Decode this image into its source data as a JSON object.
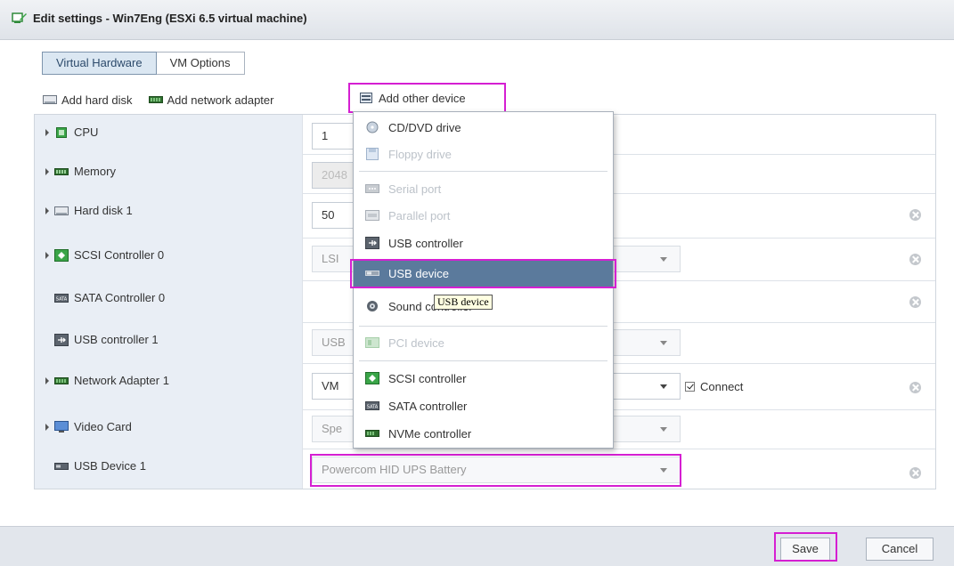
{
  "window": {
    "title": "Edit settings - Win7Eng (ESXi 6.5 virtual machine)"
  },
  "tabs": [
    {
      "label": "Virtual Hardware"
    },
    {
      "label": "VM Options"
    }
  ],
  "toolbar": {
    "add_hard_disk": "Add hard disk",
    "add_network_adapter": "Add network adapter",
    "add_other_device": "Add other device"
  },
  "hardware": [
    {
      "label": "CPU",
      "value": "1",
      "expandable": true
    },
    {
      "label": "Memory",
      "value": "2048",
      "expandable": true
    },
    {
      "label": "Hard disk 1",
      "value": "50",
      "expandable": true
    },
    {
      "label": "SCSI Controller 0",
      "value": "LSI",
      "expandable": true
    },
    {
      "label": "SATA Controller 0",
      "value": "",
      "expandable": false
    },
    {
      "label": "USB controller 1",
      "value": "USB",
      "expandable": false
    },
    {
      "label": "Network Adapter 1",
      "value": "VM",
      "expandable": true,
      "connect": "Connect"
    },
    {
      "label": "Video Card",
      "value": "Spe",
      "expandable": true
    },
    {
      "label": "USB Device 1",
      "value": "Powercom HID UPS Battery",
      "expandable": false
    }
  ],
  "menu": {
    "items": [
      {
        "label": "CD/DVD drive",
        "enabled": true,
        "icon": "disc-icon"
      },
      {
        "label": "Floppy drive",
        "enabled": false,
        "icon": "floppy-icon"
      },
      {
        "label": "Serial port",
        "enabled": false,
        "icon": "serial-port-icon"
      },
      {
        "label": "Parallel port",
        "enabled": false,
        "icon": "parallel-port-icon"
      },
      {
        "label": "USB controller",
        "enabled": true,
        "icon": "usb-controller-icon"
      },
      {
        "label": "USB device",
        "enabled": true,
        "active": true,
        "icon": "usb-device-icon"
      },
      {
        "label": "Sound controller",
        "enabled": true,
        "icon": "sound-icon"
      },
      {
        "label": "PCI device",
        "enabled": false,
        "icon": "pci-icon"
      },
      {
        "label": "SCSI controller",
        "enabled": true,
        "icon": "scsi-icon"
      },
      {
        "label": "SATA controller",
        "enabled": true,
        "icon": "sata-icon"
      },
      {
        "label": "NVMe controller",
        "enabled": true,
        "icon": "nvme-icon"
      }
    ]
  },
  "tooltip": {
    "text": "USB device"
  },
  "footer": {
    "save": "Save",
    "cancel": "Cancel"
  },
  "colors": {
    "highlight": "#d51fd2",
    "menu_active": "#5b7a9c",
    "label_bg": "#e9eef5"
  }
}
